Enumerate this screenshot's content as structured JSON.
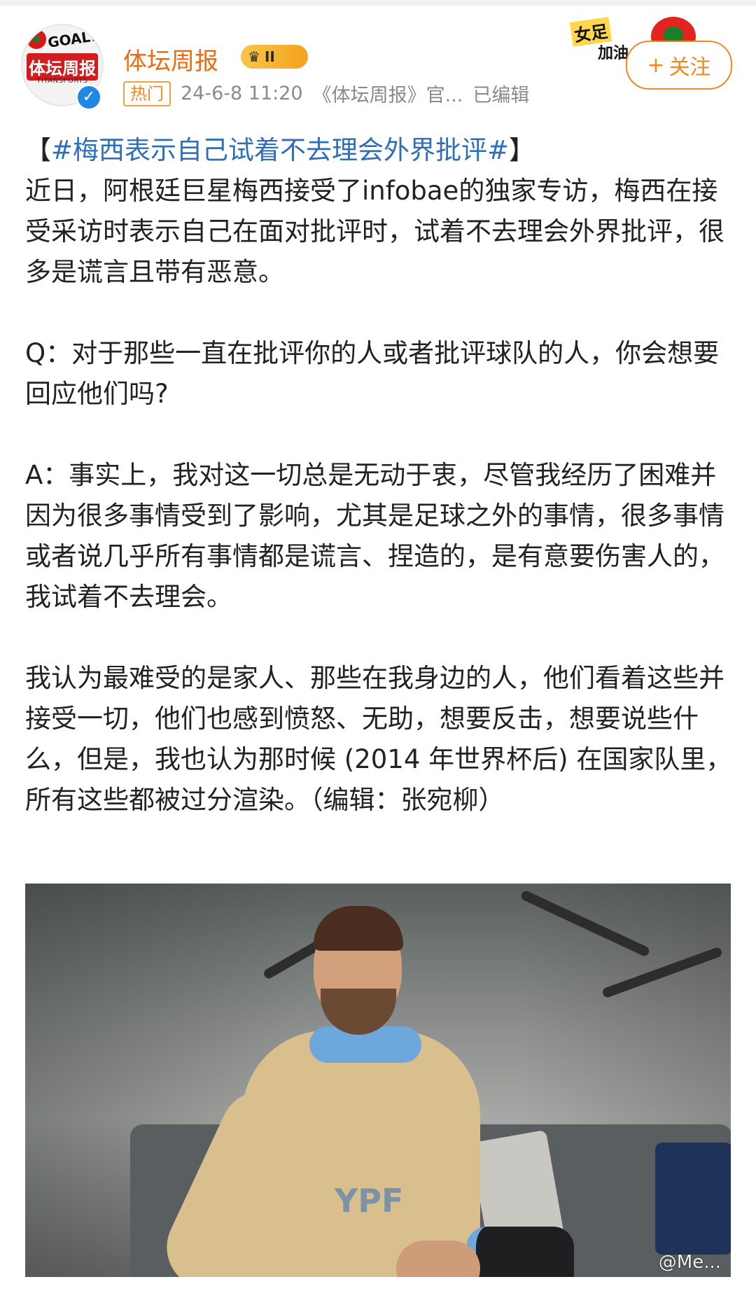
{
  "header": {
    "avatar": {
      "line1": "GOAL!",
      "line2": "体坛周报",
      "line3": "TITANSPORTS"
    },
    "name": "体坛周报",
    "level_badge": "II",
    "meta": {
      "hot_badge": "热门",
      "time": "24-6-8 11:20",
      "source": "《体坛周报》官...",
      "edited": "已编辑"
    },
    "decoration": {
      "line1": "女足",
      "line2": "加油"
    },
    "follow_button": {
      "icon_text": "+",
      "label": "关注"
    }
  },
  "post": {
    "hashtag": "#梅西表示自己试着不去理会外界批评#",
    "bracket_left": "【",
    "bracket_right": "】",
    "paragraphs": [
      "近日，阿根廷巨星梅西接受了infobae的独家专访，梅西在接受采访时表示自己在面对批评时，试着不去理会外界批评，很多是谎言且带有恶意。",
      "Q：对于那些一直在批评你的人或者批评球队的人，你会想要回应他们吗?",
      "A：事实上，我对这一切总是无动于衷，尽管我经历了困难并因为很多事情受到了影响，尤其是足球之外的事情，很多事情或者说几乎所有事情都是谎言、捏造的，是有意要伤害人的，我试着不去理会。",
      "我认为最难受的是家人、那些在我身边的人，他们看着这些并接受一切，他们也感到愤怒、无助，想要反击，想要说些什么，但是，我也认为那时候 (2014 年世界杯后) 在国家队里，所有这些都被过分渲染。（编辑：张宛柳）"
    ]
  },
  "image": {
    "jersey_text": "YPF",
    "watermark": "@Me..."
  }
}
